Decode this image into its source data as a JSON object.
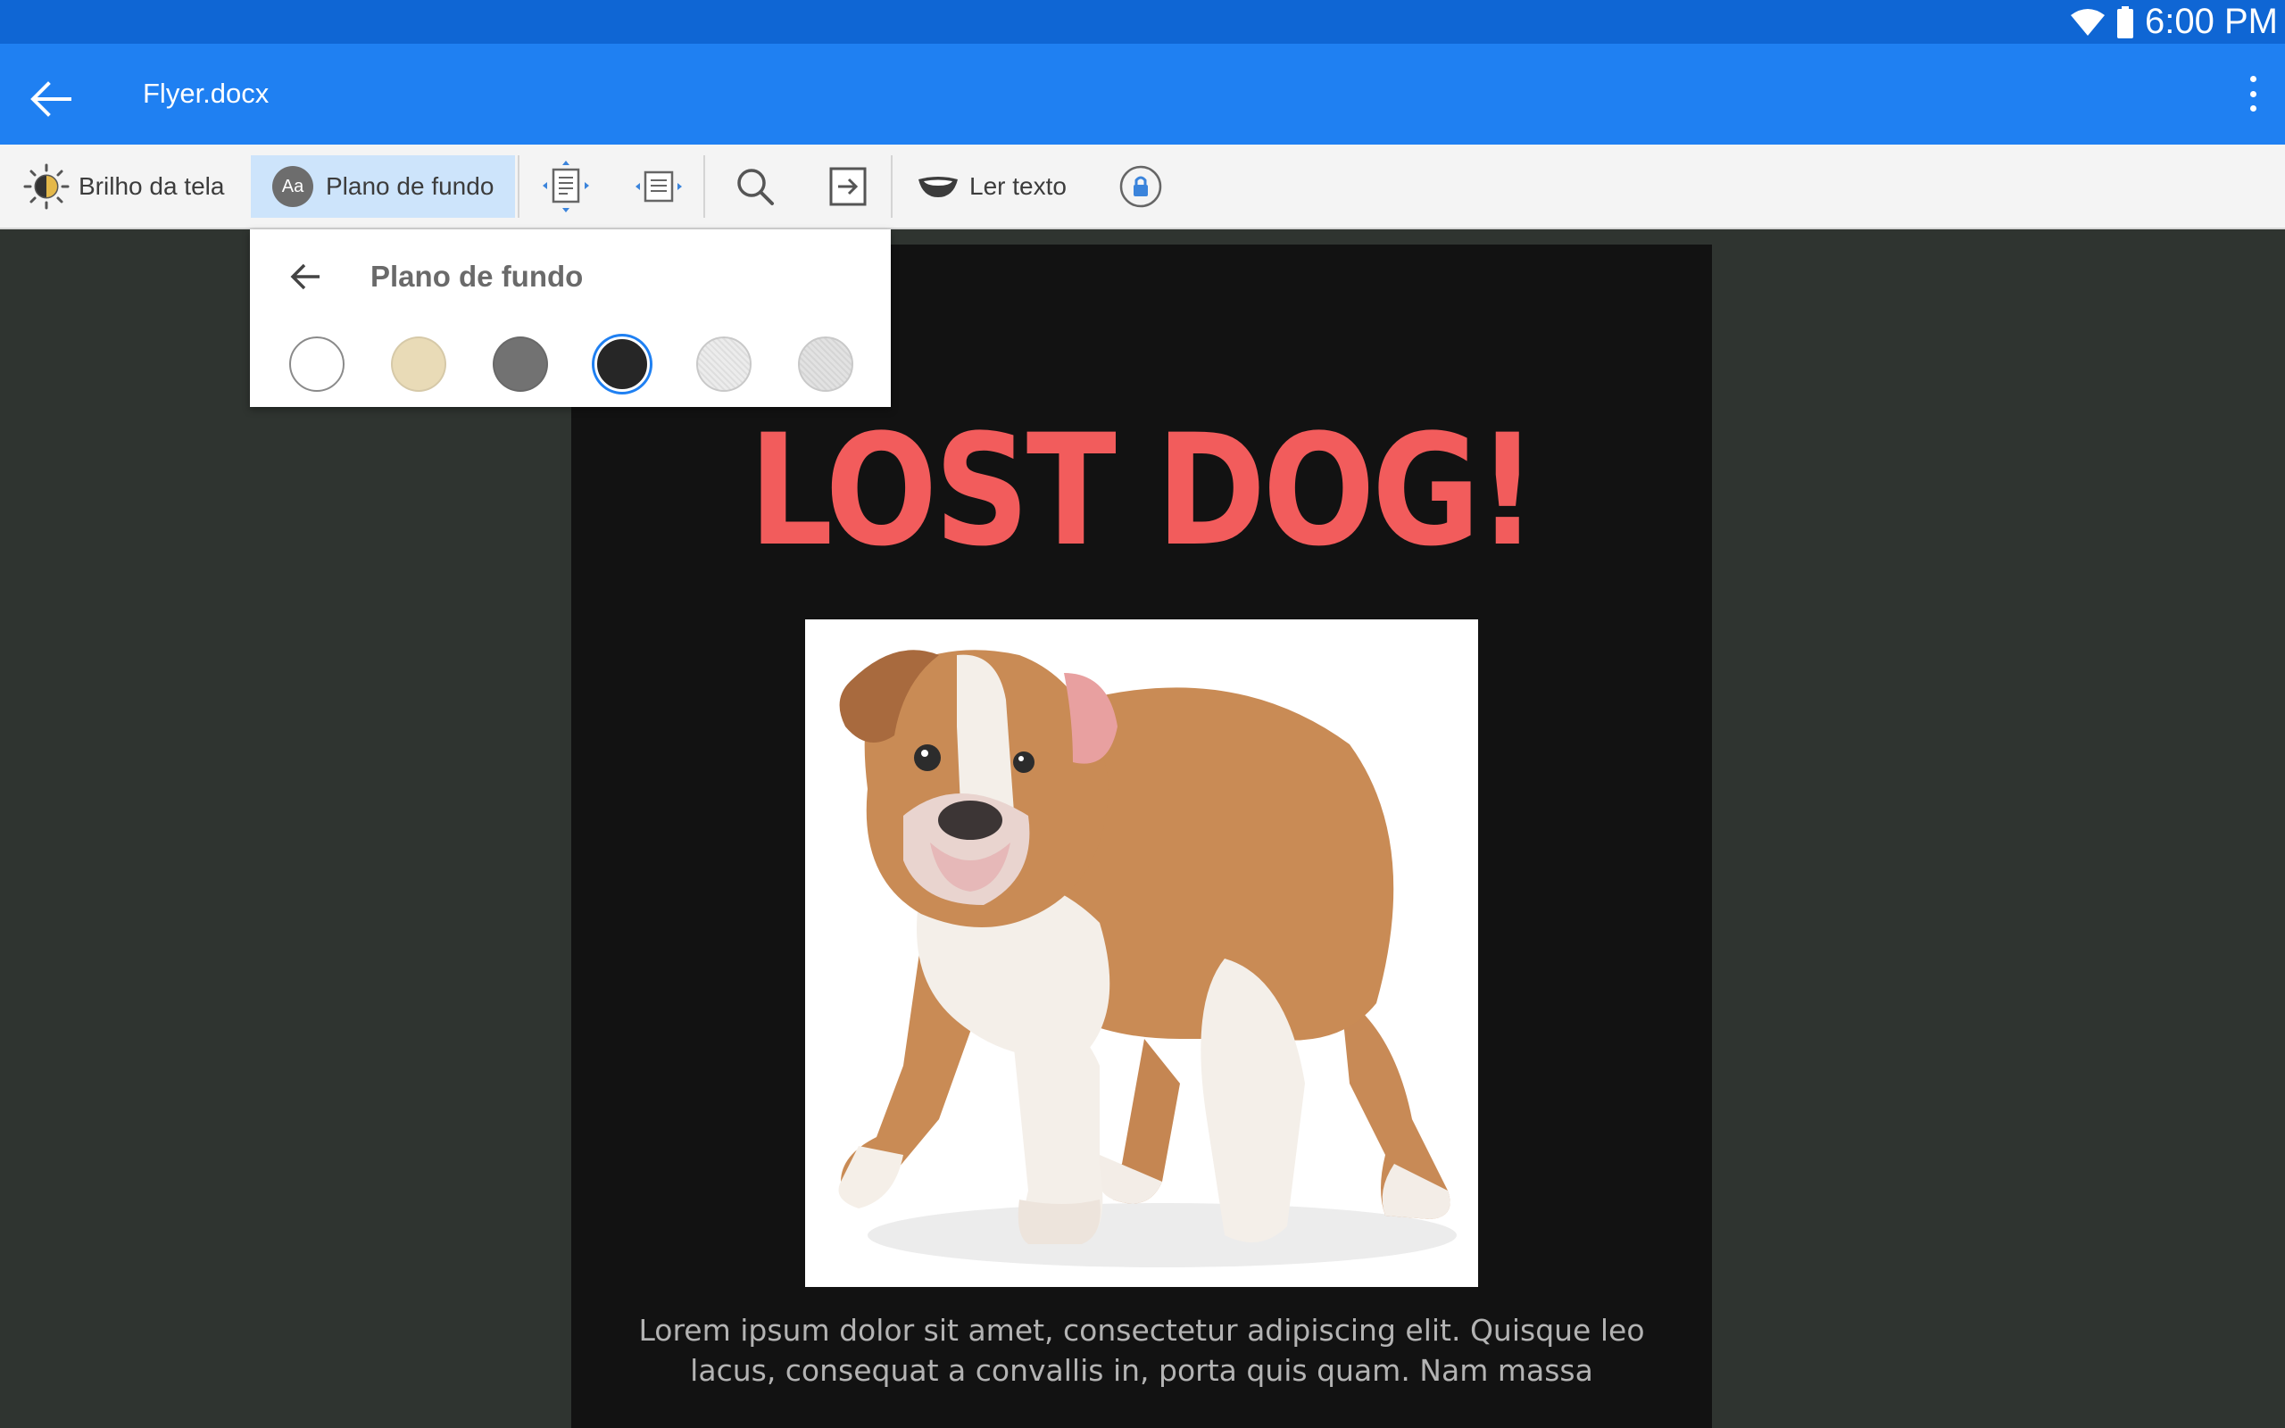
{
  "status_bar": {
    "time": "6:00 PM",
    "icons": [
      "wifi-icon",
      "battery-icon"
    ]
  },
  "app_bar": {
    "title": "Flyer.docx",
    "back_icon": "arrow-back-icon",
    "menu_icon": "more-vert-icon"
  },
  "toolbar": {
    "brightness_label": "Brilho da tela",
    "background_label": "Plano de fundo",
    "background_icon_text": "Aa",
    "read_text_label": "Ler texto",
    "icons": [
      "brightness-icon",
      "background-icon",
      "fit-page-icon",
      "fit-width-icon",
      "search-icon",
      "go-to-page-icon",
      "read-aloud-icon",
      "lock-rotation-icon"
    ]
  },
  "background_popup": {
    "title": "Plano de fundo",
    "selected_index": 3,
    "swatches": [
      {
        "name": "white",
        "color": "#ffffff"
      },
      {
        "name": "sepia",
        "color": "#e9dbb7"
      },
      {
        "name": "gray",
        "color": "#727272"
      },
      {
        "name": "black",
        "color": "#262626"
      },
      {
        "name": "texture-light",
        "color": "#ececec"
      },
      {
        "name": "texture-paper",
        "color": "#e2e2e2"
      }
    ]
  },
  "document": {
    "headline": "LOST DOG!",
    "body": "Lorem ipsum dolor sit amet, consectetur adipiscing elit. Quisque leo lacus, consequat a convallis in, porta quis quam. Nam massa",
    "body_line1": "Lorem ipsum dolor sit amet, consectetur adipiscing elit. Quisque leo",
    "body_line2": "lacus, consequat a convallis in, porta quis quam. Nam massa",
    "image": "bulldog-puppy-photo"
  },
  "colors": {
    "status_bar": "#0f66d4",
    "app_bar": "#1f80f2",
    "toolbar": "#f4f4f4",
    "active_tool": "#cde4fb",
    "canvas": "#2f3430",
    "page": "#121212",
    "headline": "#f25c5c"
  }
}
